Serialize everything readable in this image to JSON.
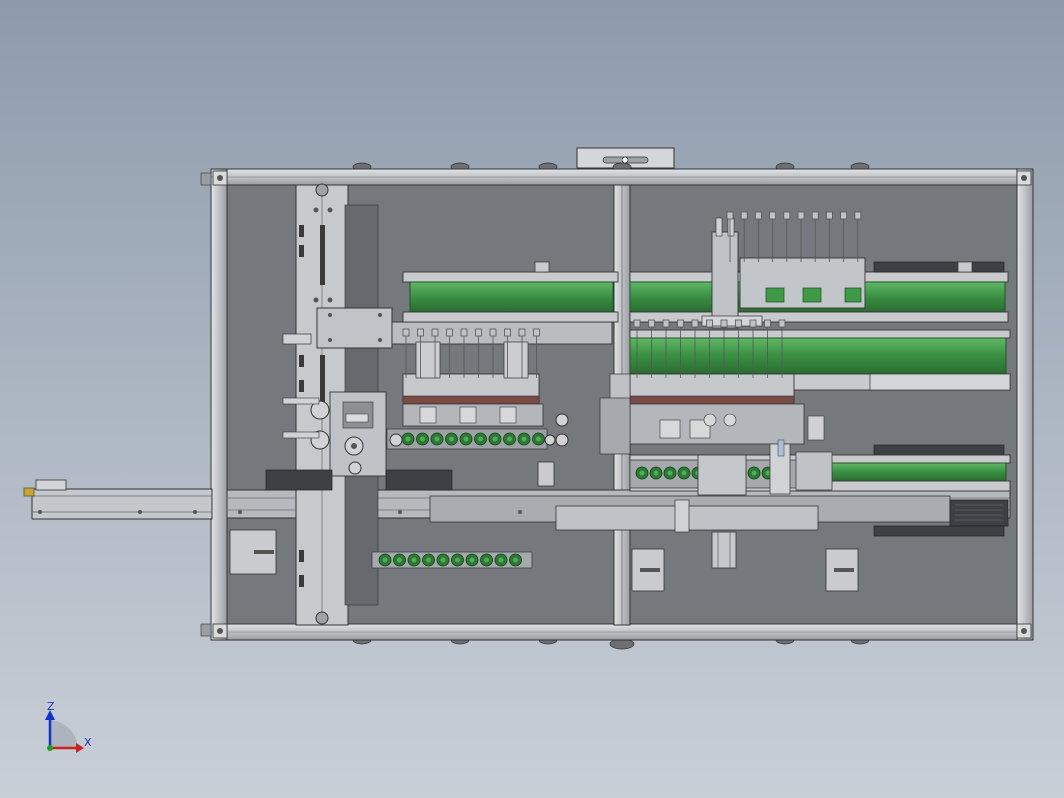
{
  "triad": {
    "z_label": "Z",
    "x_label": "X",
    "colors": {
      "z_axis": "#1030d0",
      "x_axis": "#d02020",
      "origin": "#20a020"
    }
  },
  "model": {
    "icon": "cad-assembly-view",
    "colors": {
      "frame": "#c9ccd0",
      "frame_edge": "#3a3a3a",
      "panel": "#74777c",
      "belt": "#3e9a45",
      "roller": "#2d7a34",
      "dark_plate": "#3d4044",
      "metal": "#b5b8bc"
    }
  }
}
